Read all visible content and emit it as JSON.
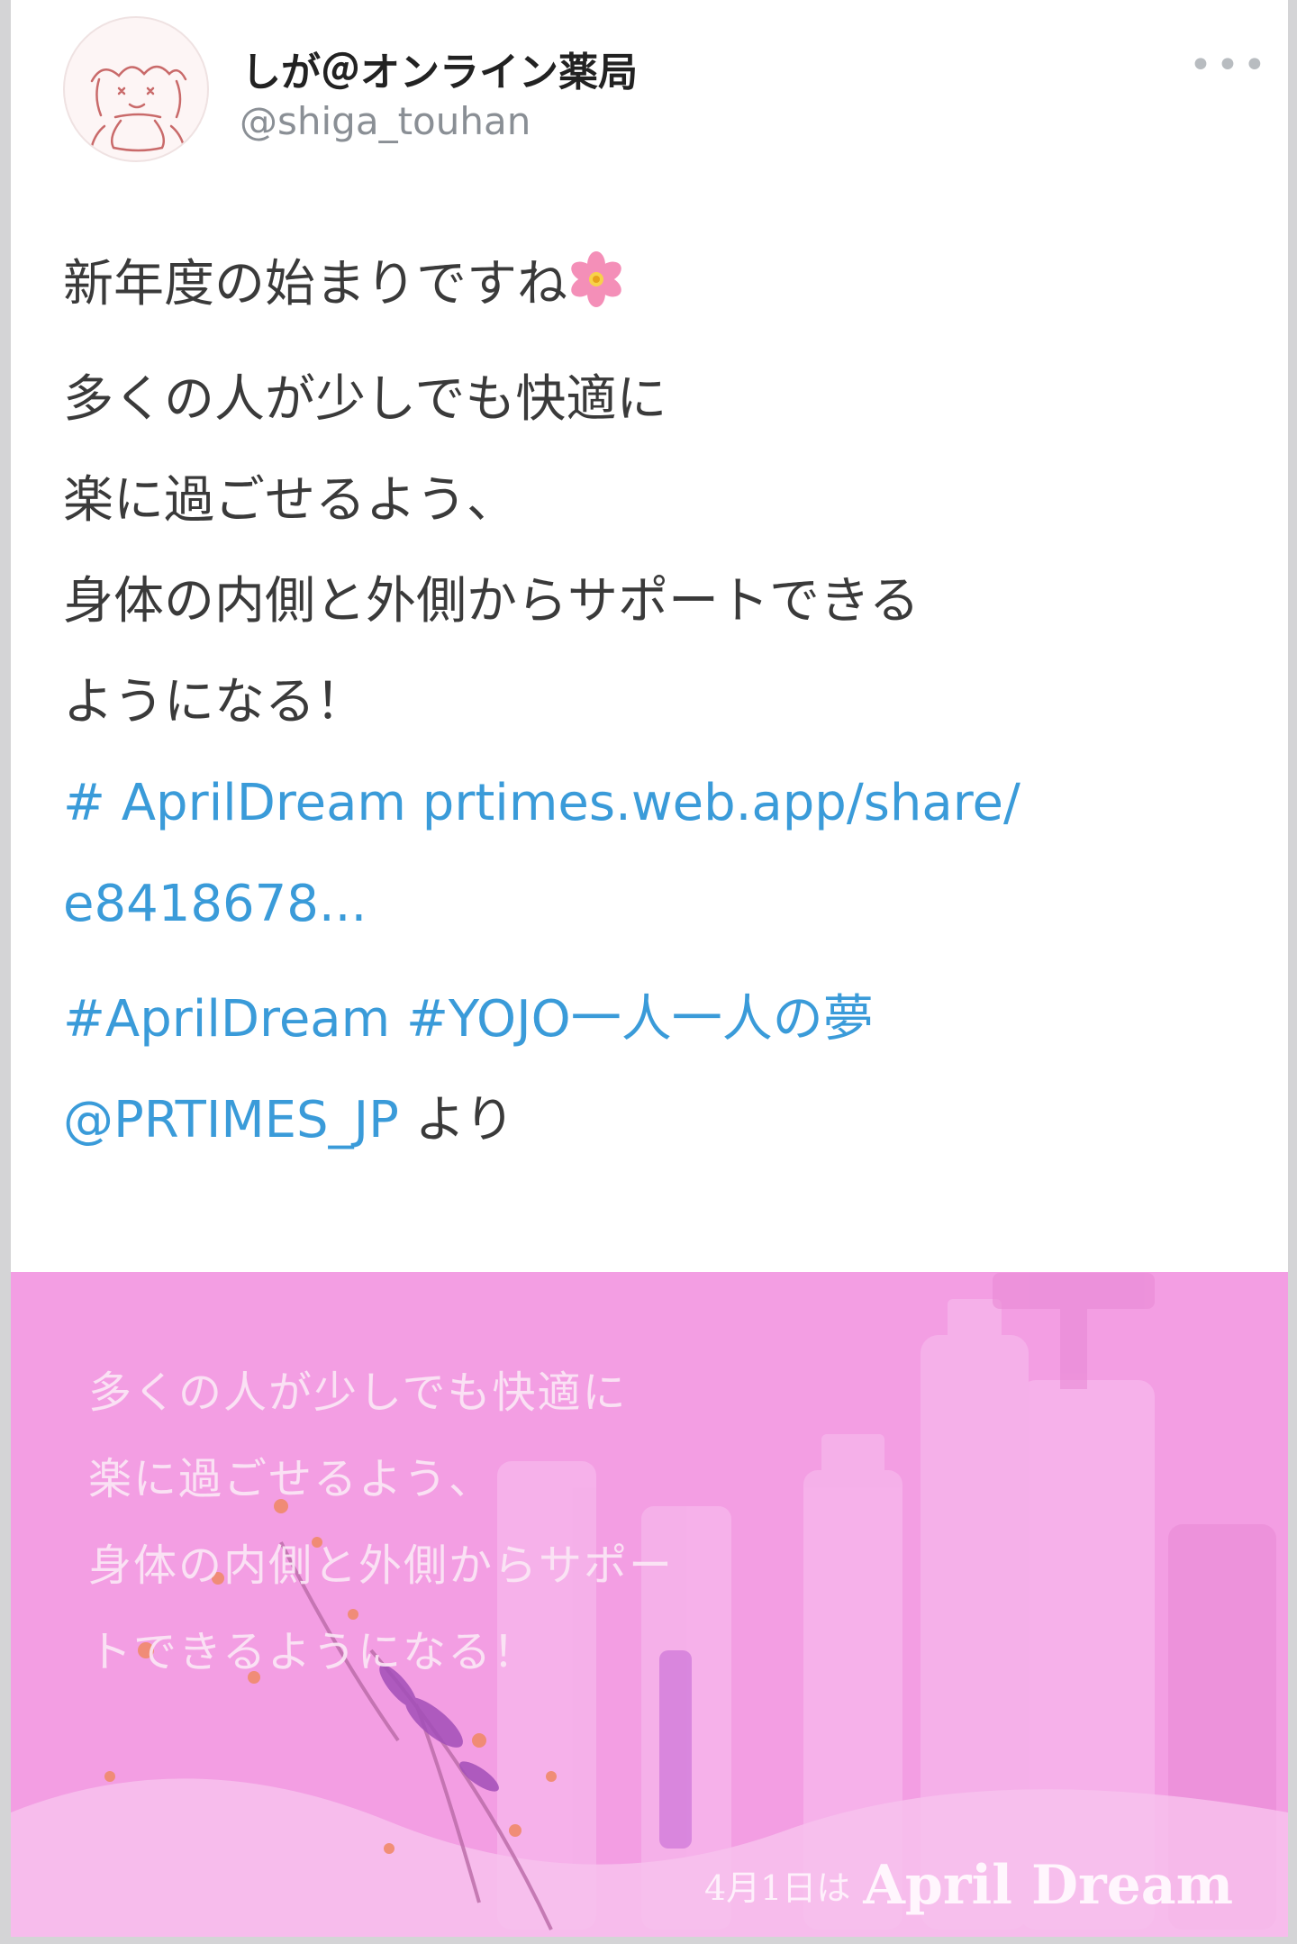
{
  "author": {
    "display_name": "しが＠オンライン薬局",
    "handle": "@shiga_touhan",
    "avatar_icon": "avatar-sketch-icon",
    "more_icon": "more-icon"
  },
  "tweet": {
    "line1": "新年度の始まりですね",
    "emoji": "flower-icon",
    "line2": "多くの人が少しでも快適に",
    "line3": "楽に過ごせるよう、",
    "line4": "身体の内側と外側からサポートできる",
    "line5": "ようになる！",
    "link_hashtag": "# AprilDream",
    "link_url": "prtimes.web.app/share/",
    "link_url_cont": "e8418678...",
    "hashtag1": "#AprilDream",
    "hashtag2": "#YOJO一人一人の夢",
    "mention": "@PRTIMES_JP",
    "mention_suffix": "より"
  },
  "media": {
    "overlay_lines": [
      "多くの人が少しでも快適に",
      "楽に過ごせるよう、",
      "身体の内側と外側からサポー",
      "トできるようになる！"
    ],
    "date_text": "4月1日は",
    "brand_text": "April Dream",
    "background_color": "#f39ee3"
  },
  "colors": {
    "link": "#3a9bd9",
    "text": "#3a3a3a",
    "handle": "#8a8f95"
  }
}
